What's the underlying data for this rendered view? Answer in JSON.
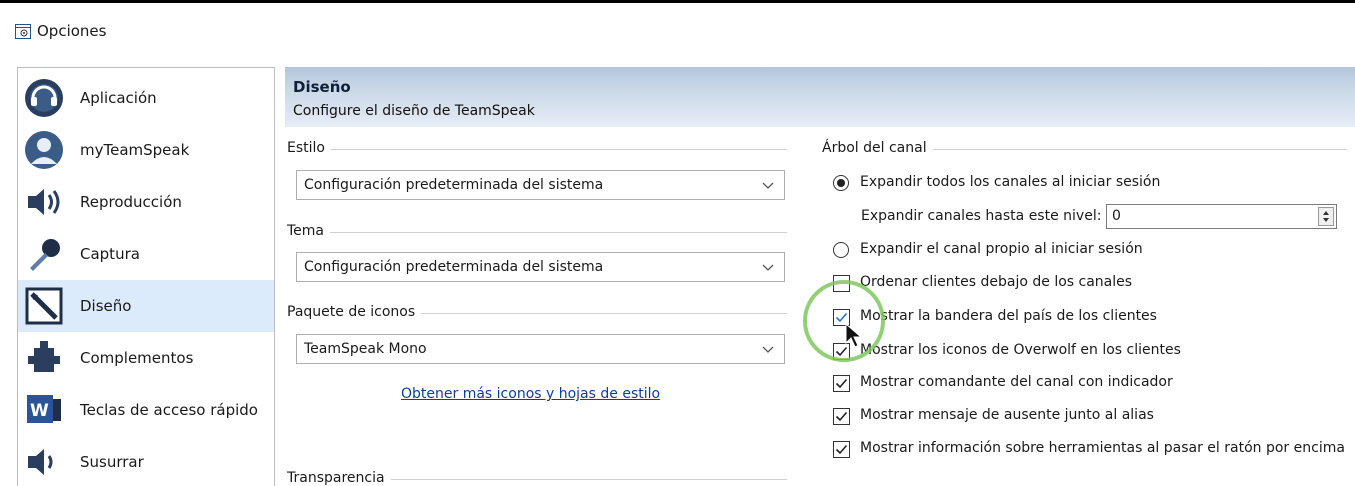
{
  "window": {
    "title": "Opciones"
  },
  "sidebar": {
    "items": [
      {
        "label": "Aplicación",
        "icon": "application-icon",
        "selected": false
      },
      {
        "label": "myTeamSpeak",
        "icon": "user-avatar-icon",
        "selected": false
      },
      {
        "label": "Reproducción",
        "icon": "speaker-icon",
        "selected": false
      },
      {
        "label": "Captura",
        "icon": "microphone-icon",
        "selected": false
      },
      {
        "label": "Diseño",
        "icon": "design-pencil-icon",
        "selected": true
      },
      {
        "label": "Complementos",
        "icon": "puzzle-plugin-icon",
        "selected": false
      },
      {
        "label": "Teclas de acceso rápido",
        "icon": "hotkey-keyboard-icon",
        "selected": false
      },
      {
        "label": "Susurrar",
        "icon": "whisper-speaker-icon",
        "selected": false
      }
    ]
  },
  "header": {
    "title": "Diseño",
    "subtitle": "Configure el diseño de TeamSpeak"
  },
  "left": {
    "style_label": "Estilo",
    "style_value": "Configuración predeterminada del sistema",
    "theme_label": "Tema",
    "theme_value": "Configuración predeterminada del sistema",
    "icons_label": "Paquete de iconos",
    "icons_value": "TeamSpeak Mono",
    "more_link": "Obtener más iconos y hojas de estilo",
    "transparency_label": "Transparencia"
  },
  "right": {
    "group_label": "Árbol del canal",
    "radio_expand_all": "Expandir todos los canales al iniciar sesión",
    "expand_level_label": "Expandir canales hasta este nivel:",
    "expand_level_value": "0",
    "radio_expand_own": "Expandir el canal propio al iniciar sesión",
    "checks": [
      {
        "label": "Ordenar clientes debajo de los canales",
        "checked": false
      },
      {
        "label": "Mostrar la bandera del país de los clientes",
        "checked": true
      },
      {
        "label": "Mostrar los iconos de Overwolf en los clientes",
        "checked": true
      },
      {
        "label": "Mostrar comandante del canal con indicador",
        "checked": true
      },
      {
        "label": "Mostrar mensaje de ausente junto al alias",
        "checked": true
      },
      {
        "label": "Mostrar información sobre herramientas al pasar el ratón por encima",
        "checked": true
      }
    ]
  },
  "colors": {
    "selected_bg": "#dcebfb",
    "header_gradient_top": "#b3c6dc",
    "link": "#0b3d9e",
    "highlight_ring": "#7ec85c"
  }
}
